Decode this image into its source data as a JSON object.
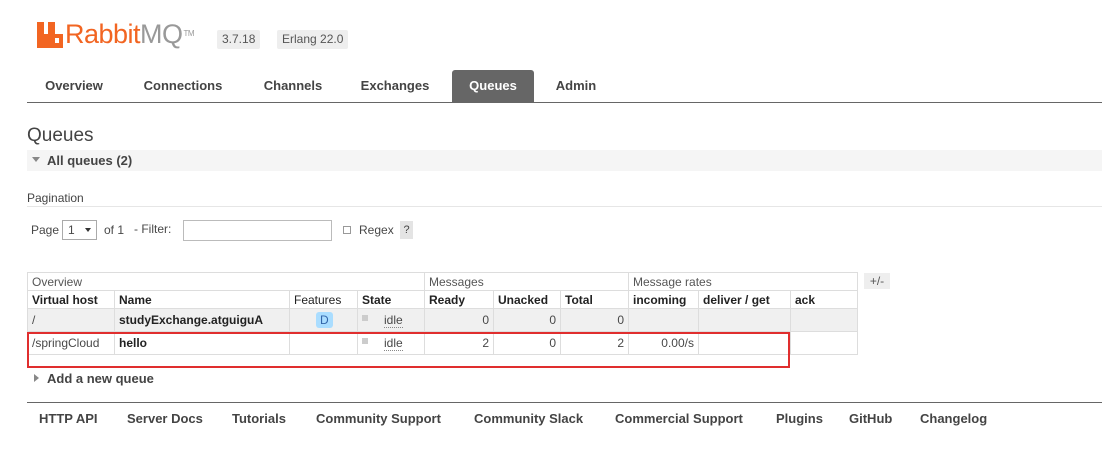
{
  "header": {
    "brand_part1": "Rabbit",
    "brand_part2": "MQ",
    "trademark": "TM",
    "version": "3.7.18",
    "erlang": "Erlang 22.0",
    "brand_color": "#f26522"
  },
  "tabs": [
    {
      "label": "Overview",
      "active": false
    },
    {
      "label": "Connections",
      "active": false
    },
    {
      "label": "Channels",
      "active": false
    },
    {
      "label": "Exchanges",
      "active": false
    },
    {
      "label": "Queues",
      "active": true
    },
    {
      "label": "Admin",
      "active": false
    }
  ],
  "page": {
    "title": "Queues",
    "section": "All queues (2)"
  },
  "pagination": {
    "heading": "Pagination",
    "page_label": "Page",
    "page_value": "1",
    "of_label": "of 1",
    "filter_label": "- Filter:",
    "filter_value": "",
    "regex_label": "Regex",
    "help": "?"
  },
  "table": {
    "groups": {
      "overview": "Overview",
      "messages": "Messages",
      "rates": "Message rates",
      "toggle": "+/-"
    },
    "columns": {
      "vhost": "Virtual host",
      "name": "Name",
      "features": "Features",
      "state": "State",
      "ready": "Ready",
      "unacked": "Unacked",
      "total": "Total",
      "incoming": "incoming",
      "deliver": "deliver / get",
      "ack": "ack"
    },
    "rows": [
      {
        "vhost": "/",
        "name": "studyExchange.atguiguA",
        "feature": "D",
        "state": "idle",
        "ready": "0",
        "unacked": "0",
        "total": "0",
        "incoming": "",
        "deliver": "",
        "ack": ""
      },
      {
        "vhost": "/springCloud",
        "name": "hello",
        "feature": "",
        "state": "idle",
        "ready": "2",
        "unacked": "0",
        "total": "2",
        "incoming": "0.00/s",
        "deliver": "",
        "ack": ""
      }
    ]
  },
  "add_queue": "Add a new queue",
  "footer": [
    "HTTP API",
    "Server Docs",
    "Tutorials",
    "Community Support",
    "Community Slack",
    "Commercial Support",
    "Plugins",
    "GitHub",
    "Changelog"
  ]
}
